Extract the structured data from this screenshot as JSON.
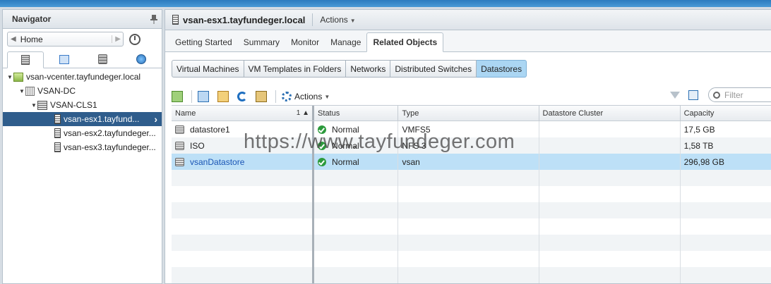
{
  "navigator": {
    "title": "Navigator",
    "home_label": "Home",
    "tabs": [
      {
        "name": "hosts-clusters",
        "icon": "host-icon"
      },
      {
        "name": "vms-templates",
        "icon": "vm-icon"
      },
      {
        "name": "storage",
        "icon": "datastore-icon"
      },
      {
        "name": "networking",
        "icon": "network-icon"
      }
    ],
    "tree": [
      {
        "label": "vsan-vcenter.tayfundeger.local",
        "icon": "vcenter-icon",
        "level": 0
      },
      {
        "label": "VSAN-DC",
        "icon": "datacenter-icon",
        "level": 1
      },
      {
        "label": "VSAN-CLS1",
        "icon": "cluster-icon",
        "level": 2
      },
      {
        "label": "vsan-esx1.tayfund...",
        "icon": "host-icon",
        "level": 3,
        "selected": true
      },
      {
        "label": "vsan-esx2.tayfundeger...",
        "icon": "host-icon",
        "level": 3
      },
      {
        "label": "vsan-esx3.tayfundeger...",
        "icon": "host-icon",
        "level": 3
      }
    ]
  },
  "main": {
    "title": "vsan-esx1.tayfundeger.local",
    "actions_label": "Actions",
    "tabs": [
      "Getting Started",
      "Summary",
      "Monitor",
      "Manage",
      "Related Objects"
    ],
    "active_tab": "Related Objects",
    "subtabs": [
      "Virtual Machines",
      "VM Templates in Folders",
      "Networks",
      "Distributed Switches",
      "Datastores"
    ],
    "active_subtab": "Datastores",
    "toolbar_actions_label": "Actions",
    "filter_placeholder": "Filter"
  },
  "grid": {
    "columns": [
      "Name",
      "Status",
      "Type",
      "Datastore Cluster",
      "Capacity"
    ],
    "sort_indicator": "1 ▲",
    "rows": [
      {
        "name": "datastore1",
        "status": "Normal",
        "type": "VMFS5",
        "cluster": "",
        "capacity": "17,5  GB"
      },
      {
        "name": "ISO",
        "status": "Normal",
        "type": "NFS 3",
        "cluster": "",
        "capacity": "1,58  TB"
      },
      {
        "name": "vsanDatastore",
        "status": "Normal",
        "type": "vsan",
        "cluster": "",
        "capacity": "296,98  GB",
        "selected": true
      }
    ]
  },
  "watermark": "https://www.tayfundeger.com",
  "colors": {
    "selection": "#bde0f7",
    "tree_selection": "#2f5d8c",
    "link": "#1a55b5",
    "status_ok": "#2c9a3c"
  }
}
